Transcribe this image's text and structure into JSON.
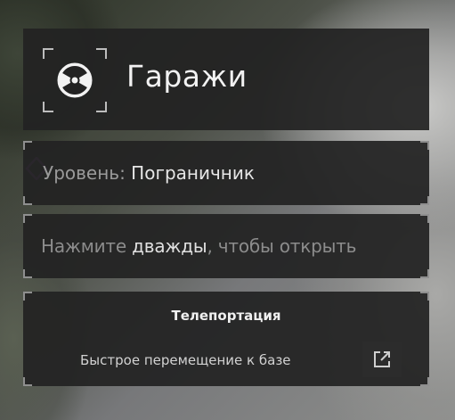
{
  "header": {
    "title": "Гаражи",
    "icon": "radiation-icon"
  },
  "level": {
    "label": "Уровень:",
    "value": "Пограничник"
  },
  "open_hint": {
    "prefix": "Нажмите ",
    "emphasis": "дважды",
    "suffix": ", чтобы открыть"
  },
  "teleport": {
    "title": "Телепортация",
    "description": "Быстрое перемещение к базе",
    "button_icon": "external-link-icon"
  },
  "colors": {
    "panel": "#222222",
    "marker": "#7a4a9a"
  }
}
